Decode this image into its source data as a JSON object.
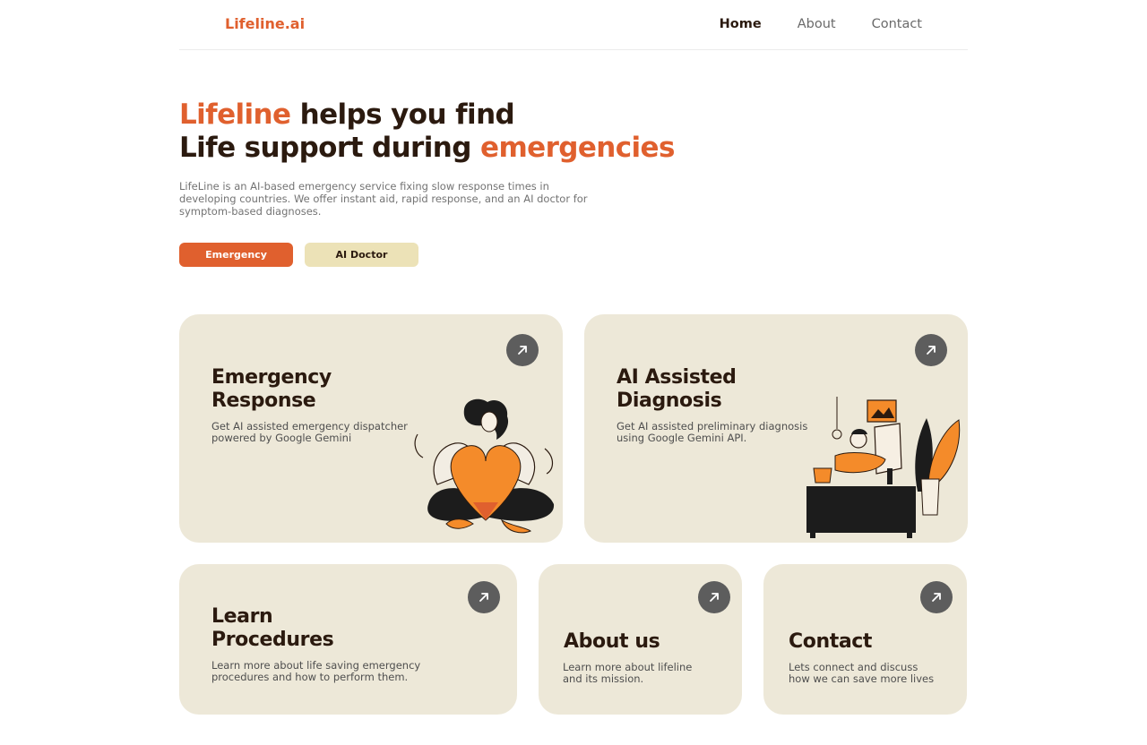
{
  "nav": {
    "logo": "Lifeline.ai",
    "links": [
      {
        "label": "Home",
        "active": true
      },
      {
        "label": "About",
        "active": false
      },
      {
        "label": "Contact",
        "active": false
      }
    ]
  },
  "hero": {
    "title_line1_accent": "Lifeline",
    "title_line1_rest": " helps you find",
    "title_line2_rest": "Life support during ",
    "title_line2_accent": "emergencies",
    "description": "LifeLine is an AI-based emergency service fixing slow response times in developing countries. We offer instant aid, rapid response, and an AI doctor for symptom-based diagnoses.",
    "buttons": {
      "emergency": "Emergency",
      "ai_doctor": "AI Doctor"
    }
  },
  "cards": {
    "emergency": {
      "title_line1": "Emergency",
      "title_line2": "Response",
      "desc_line1": "Get AI assisted emergency dispatcher",
      "desc_line2": "powered by Google Gemini",
      "icon": "arrow-up-right-icon"
    },
    "diagnosis": {
      "title_line1": "AI Assisted",
      "title_line2": "Diagnosis",
      "desc_line1": "Get AI assisted preliminary diagnosis",
      "desc_line2": "using Google Gemini API.",
      "icon": "arrow-up-right-icon"
    },
    "learn": {
      "title_line1": "Learn",
      "title_line2": "Procedures",
      "desc_line1": "Learn more about life saving emergency",
      "desc_line2": "procedures and how to perform them.",
      "icon": "arrow-up-right-icon"
    },
    "about": {
      "title": "About us",
      "desc_line1": "Learn more about lifeline",
      "desc_line2": "and its mission.",
      "icon": "arrow-up-right-icon"
    },
    "contact": {
      "title": "Contact",
      "desc_line1": "Lets connect and discuss",
      "desc_line2": "how we can save more lives",
      "icon": "arrow-up-right-icon"
    }
  },
  "colors": {
    "accent": "#e0602e",
    "dark_text": "#2b1a0f",
    "card_bg": "#ede8d8",
    "secondary_button": "#ece2b7",
    "arrow_button": "#5d5d5d"
  }
}
